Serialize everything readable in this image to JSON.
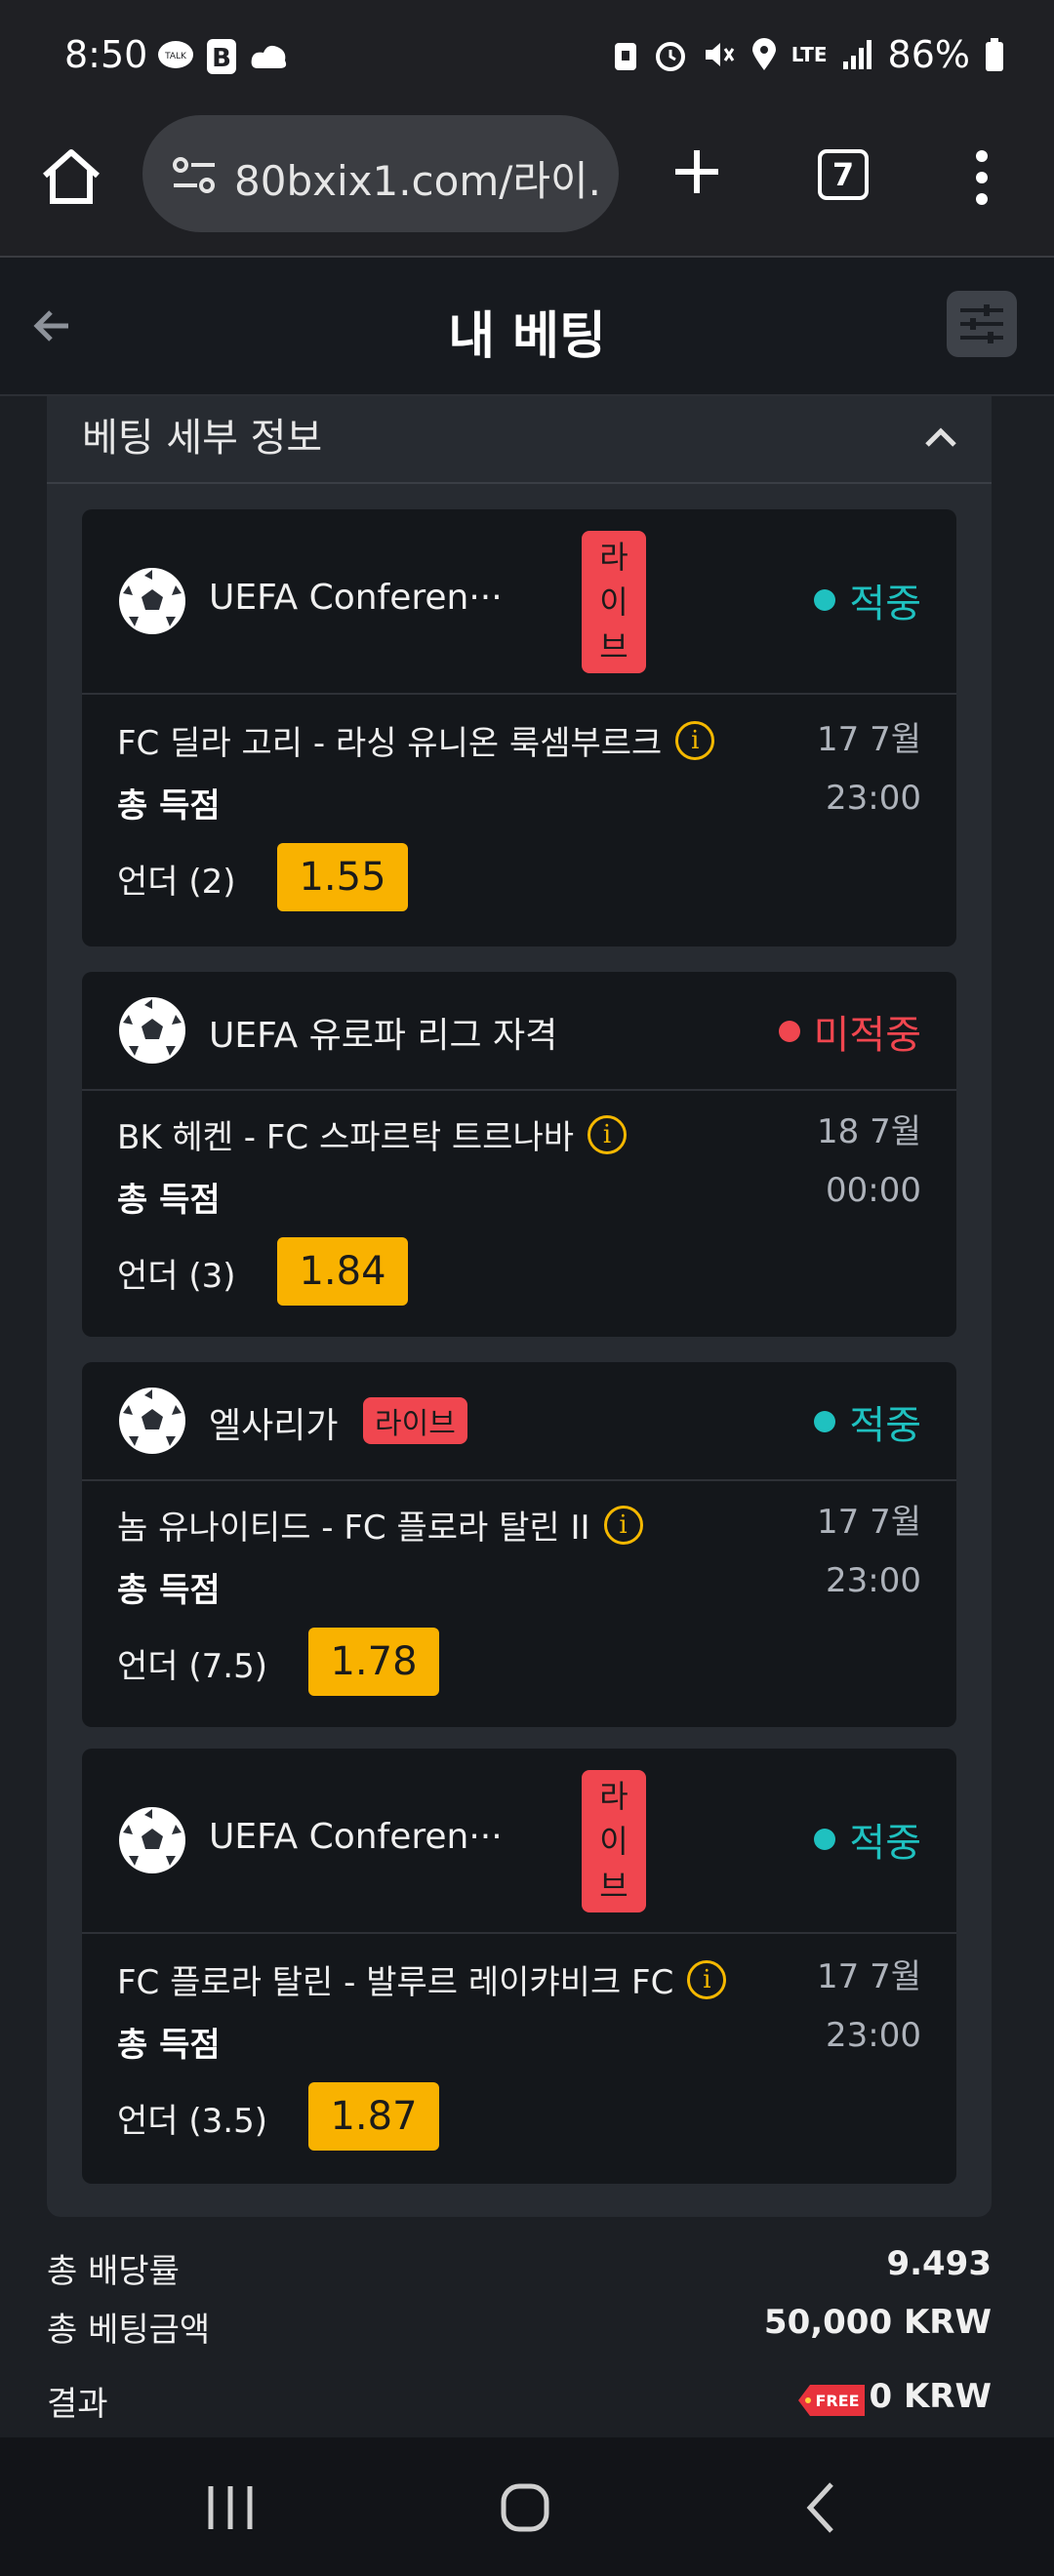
{
  "status_bar": {
    "time": "8:50",
    "battery": "86%",
    "network": "LTE"
  },
  "browser": {
    "url": "80bxix1.com/라이...",
    "tab_count": "7"
  },
  "header": {
    "title": "내 베팅"
  },
  "panel": {
    "title": "베팅 세부 정보"
  },
  "bets": [
    {
      "league": "UEFA Conferen···",
      "live_label": "라\n이\n브",
      "status": "적중",
      "status_color": "#1fc1c0",
      "match": "FC 딜라 고리 - 라싱 유니온 룩셈부르크",
      "market": "총 득점",
      "pick": "언더 (2)",
      "odds": "1.55",
      "date": "17 7월",
      "time": "23:00"
    },
    {
      "league": "UEFA 유로파 리그 자격",
      "live_label": "",
      "status": "미적중",
      "status_color": "#f0464f",
      "match": "BK 헤켄 - FC 스파르탁 트르나바",
      "market": "총 득점",
      "pick": "언더 (3)",
      "odds": "1.84",
      "date": "18 7월",
      "time": "00:00"
    },
    {
      "league": "엘사리가",
      "live_label": "라이브",
      "status": "적중",
      "status_color": "#1fc1c0",
      "match": "놈 유나이티드 - FC 플로라 탈린 II",
      "market": "총 득점",
      "pick": "언더 (7.5)",
      "odds": "1.78",
      "date": "17 7월",
      "time": "23:00"
    },
    {
      "league": "UEFA Conferen···",
      "live_label": "라\n이\n브",
      "status": "적중",
      "status_color": "#1fc1c0",
      "match": "FC 플로라 탈린 - 발루르 레이캬비크 FC",
      "market": "총 득점",
      "pick": "언더 (3.5)",
      "odds": "1.87",
      "date": "17 7월",
      "time": "23:00"
    }
  ],
  "summary": {
    "total_odds_label": "총 배당률",
    "total_odds": "9.493",
    "total_stake_label": "총 베팅금액",
    "total_stake": "50,000 KRW",
    "result_label": "결과",
    "free_tag": "FREE",
    "result": "0 KRW"
  },
  "colors": {
    "accent_odds": "#f9b200",
    "won": "#1fc1c0",
    "lost": "#f0464f",
    "live": "#f0464f"
  }
}
